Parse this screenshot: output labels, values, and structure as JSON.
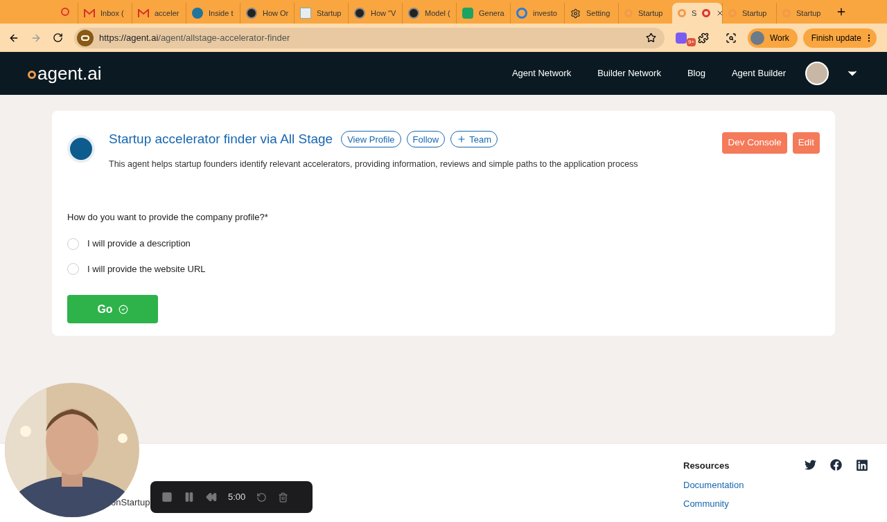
{
  "browser": {
    "tabs": [
      {
        "title": "Inbox (",
        "kind": "gmail",
        "selected": false
      },
      {
        "title": "acceler",
        "kind": "gmail",
        "selected": false
      },
      {
        "title": "Inside t",
        "kind": "wordpress",
        "selected": false
      },
      {
        "title": "How Or",
        "kind": "circle",
        "selected": false
      },
      {
        "title": "Startup",
        "kind": "square",
        "selected": false
      },
      {
        "title": "How \"V",
        "kind": "circle",
        "selected": false
      },
      {
        "title": "Model (",
        "kind": "circle",
        "selected": false
      },
      {
        "title": "Genera",
        "kind": "sheets",
        "selected": false
      },
      {
        "title": "investo",
        "kind": "ring",
        "selected": false
      },
      {
        "title": "Setting",
        "kind": "gear",
        "selected": false
      },
      {
        "title": "Startup",
        "kind": "agent",
        "selected": false
      },
      {
        "title": "S",
        "kind": "agent",
        "selected": true
      },
      {
        "title": "Startup",
        "kind": "agent",
        "selected": false
      },
      {
        "title": "Startup",
        "kind": "agent",
        "selected": false
      }
    ],
    "url_host": "https://agent.ai",
    "url_path": "/agent/allstage-accelerator-finder",
    "extension_badge": "9+",
    "profile": "Work",
    "update_button": "Finish update"
  },
  "nav": {
    "logo": "agent.ai",
    "links": [
      "Agent Network",
      "Builder Network",
      "Blog",
      "Agent Builder"
    ]
  },
  "agent": {
    "title": "Startup accelerator finder via All Stage",
    "actions": [
      "View Profile",
      "Follow",
      "Team"
    ],
    "description": "This agent helps startup founders identify relevant accelerators, providing information, reviews and simple paths to the application process",
    "buttons": [
      "Dev Console",
      "Edit"
    ]
  },
  "form": {
    "question": "How do you want to provide the company profile?",
    "required_mark": "*",
    "options": [
      {
        "label": "I will provide a description",
        "selected": false
      },
      {
        "label": "I will provide the website URL",
        "selected": false
      }
    ],
    "submit": "Go"
  },
  "footer": {
    "partial_text": "onStartup",
    "heading": "Resources",
    "links": [
      "Documentation",
      "Community"
    ]
  },
  "recorder": {
    "time": "5:00"
  }
}
